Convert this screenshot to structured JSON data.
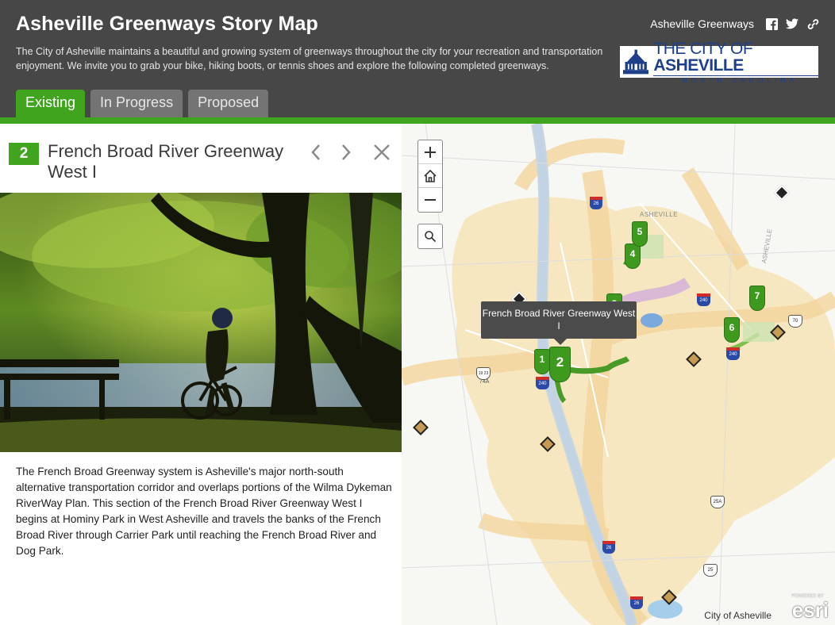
{
  "header": {
    "title": "Asheville Greenways Story Map",
    "description": "The City of Asheville maintains a beautiful and growing system of greenways throughout the city for your recreation and transportation enjoyment. We invite you to grab your bike, hiking boots, or tennis shoes and explore the following completed greenways.",
    "share_label": "Asheville Greenways",
    "share_icons": [
      "facebook-icon",
      "twitter-icon",
      "link-icon"
    ],
    "logo": {
      "main_prefix": "THE CITY OF ",
      "main_bold": "ASHEVILLE",
      "sub": "NORTH CAROLINA"
    }
  },
  "tabs": [
    {
      "label": "Existing",
      "active": true
    },
    {
      "label": "In Progress",
      "active": false
    },
    {
      "label": "Proposed",
      "active": false
    }
  ],
  "panel": {
    "number": "2",
    "title": "French Broad River Greenway West I",
    "body": "The French Broad Greenway system is Asheville's major north-south alternative transportation corridor and overlaps portions of the Wilma Dykeman RiverWay Plan.  This section of the French Broad River Greenway West I begins at Hominy Park in West Asheville and travels the banks of the French Broad River through Carrier Park until reaching the French Broad River and Dog Park."
  },
  "map": {
    "tooltip": "French Broad River Greenway West I",
    "city_label": "ASHEVILLE",
    "road_label": "ASHEVILLE",
    "markers": [
      "1",
      "2",
      "3",
      "4",
      "5",
      "6",
      "7"
    ],
    "shields": [
      "26",
      "240",
      "240",
      "240",
      "26",
      "26",
      "70",
      "25A",
      "25",
      "19 23",
      "74A"
    ],
    "attribution": "City of Asheville",
    "esri_text": "esri",
    "esri_powered": "POWERED BY"
  },
  "colors": {
    "header_bg": "#474747",
    "accent_green": "#41a41f",
    "tab_inactive": "#747474",
    "city_fill": "#f7e9c4",
    "road_buffer": "#f5d9a3"
  }
}
